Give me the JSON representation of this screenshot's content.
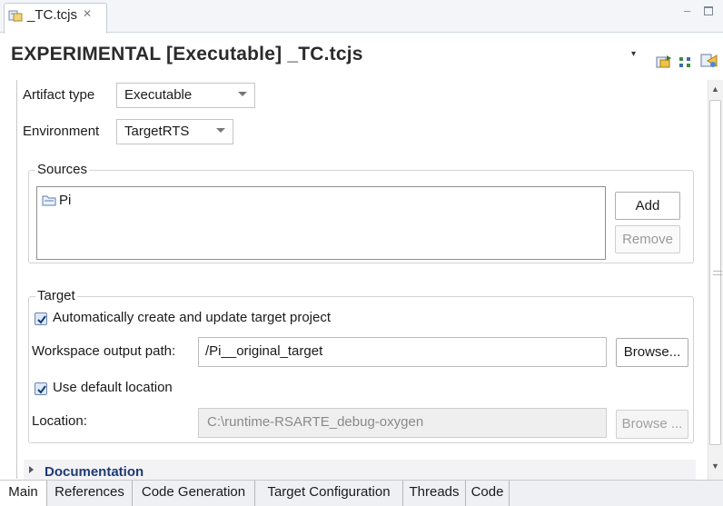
{
  "editor_tab": {
    "label": "_TC.tcjs",
    "close_glyph": "✕",
    "icon": "tc-file-icon"
  },
  "window": {
    "minimize_glyph": "–"
  },
  "header": {
    "title": "EXPERIMENTAL [Executable] _TC.tcjs",
    "menu_glyph": "▾",
    "icons": [
      "export-icon",
      "grid-icon",
      "build-icon"
    ]
  },
  "main": {
    "artifact_type": {
      "label": "Artifact type",
      "value": "Executable"
    },
    "environment": {
      "label": "Environment",
      "value": "TargetRTS"
    },
    "sources": {
      "title": "Sources",
      "items": [
        {
          "label": "Pi",
          "icon": "folder-icon"
        }
      ],
      "add_label": "Add",
      "remove_label": "Remove"
    },
    "target": {
      "title": "Target",
      "auto_create_label": "Automatically create and update target project",
      "auto_create_checked": true,
      "workspace_output_label": "Workspace output path:",
      "workspace_output_value": "/Pi__original_target",
      "browse_label": "Browse...",
      "use_default_label": "Use default location",
      "use_default_checked": true,
      "location_label": "Location:",
      "location_value": "C:\\runtime-RSARTE_debug-oxygen",
      "browse_disabled_label": "Browse ..."
    },
    "documentation": {
      "label": "Documentation"
    }
  },
  "page_tabs": [
    {
      "label": "Main",
      "active": true
    },
    {
      "label": "References",
      "active": false
    },
    {
      "label": "Code Generation",
      "active": false
    },
    {
      "label": "Target Configuration",
      "active": false
    },
    {
      "label": "Threads",
      "active": false
    },
    {
      "label": "Code",
      "active": false
    }
  ],
  "colors": {
    "doc_link": "#1f3a78",
    "checkbox_fill": "#dce9fb",
    "tab_strip": "#f3f5f9"
  }
}
